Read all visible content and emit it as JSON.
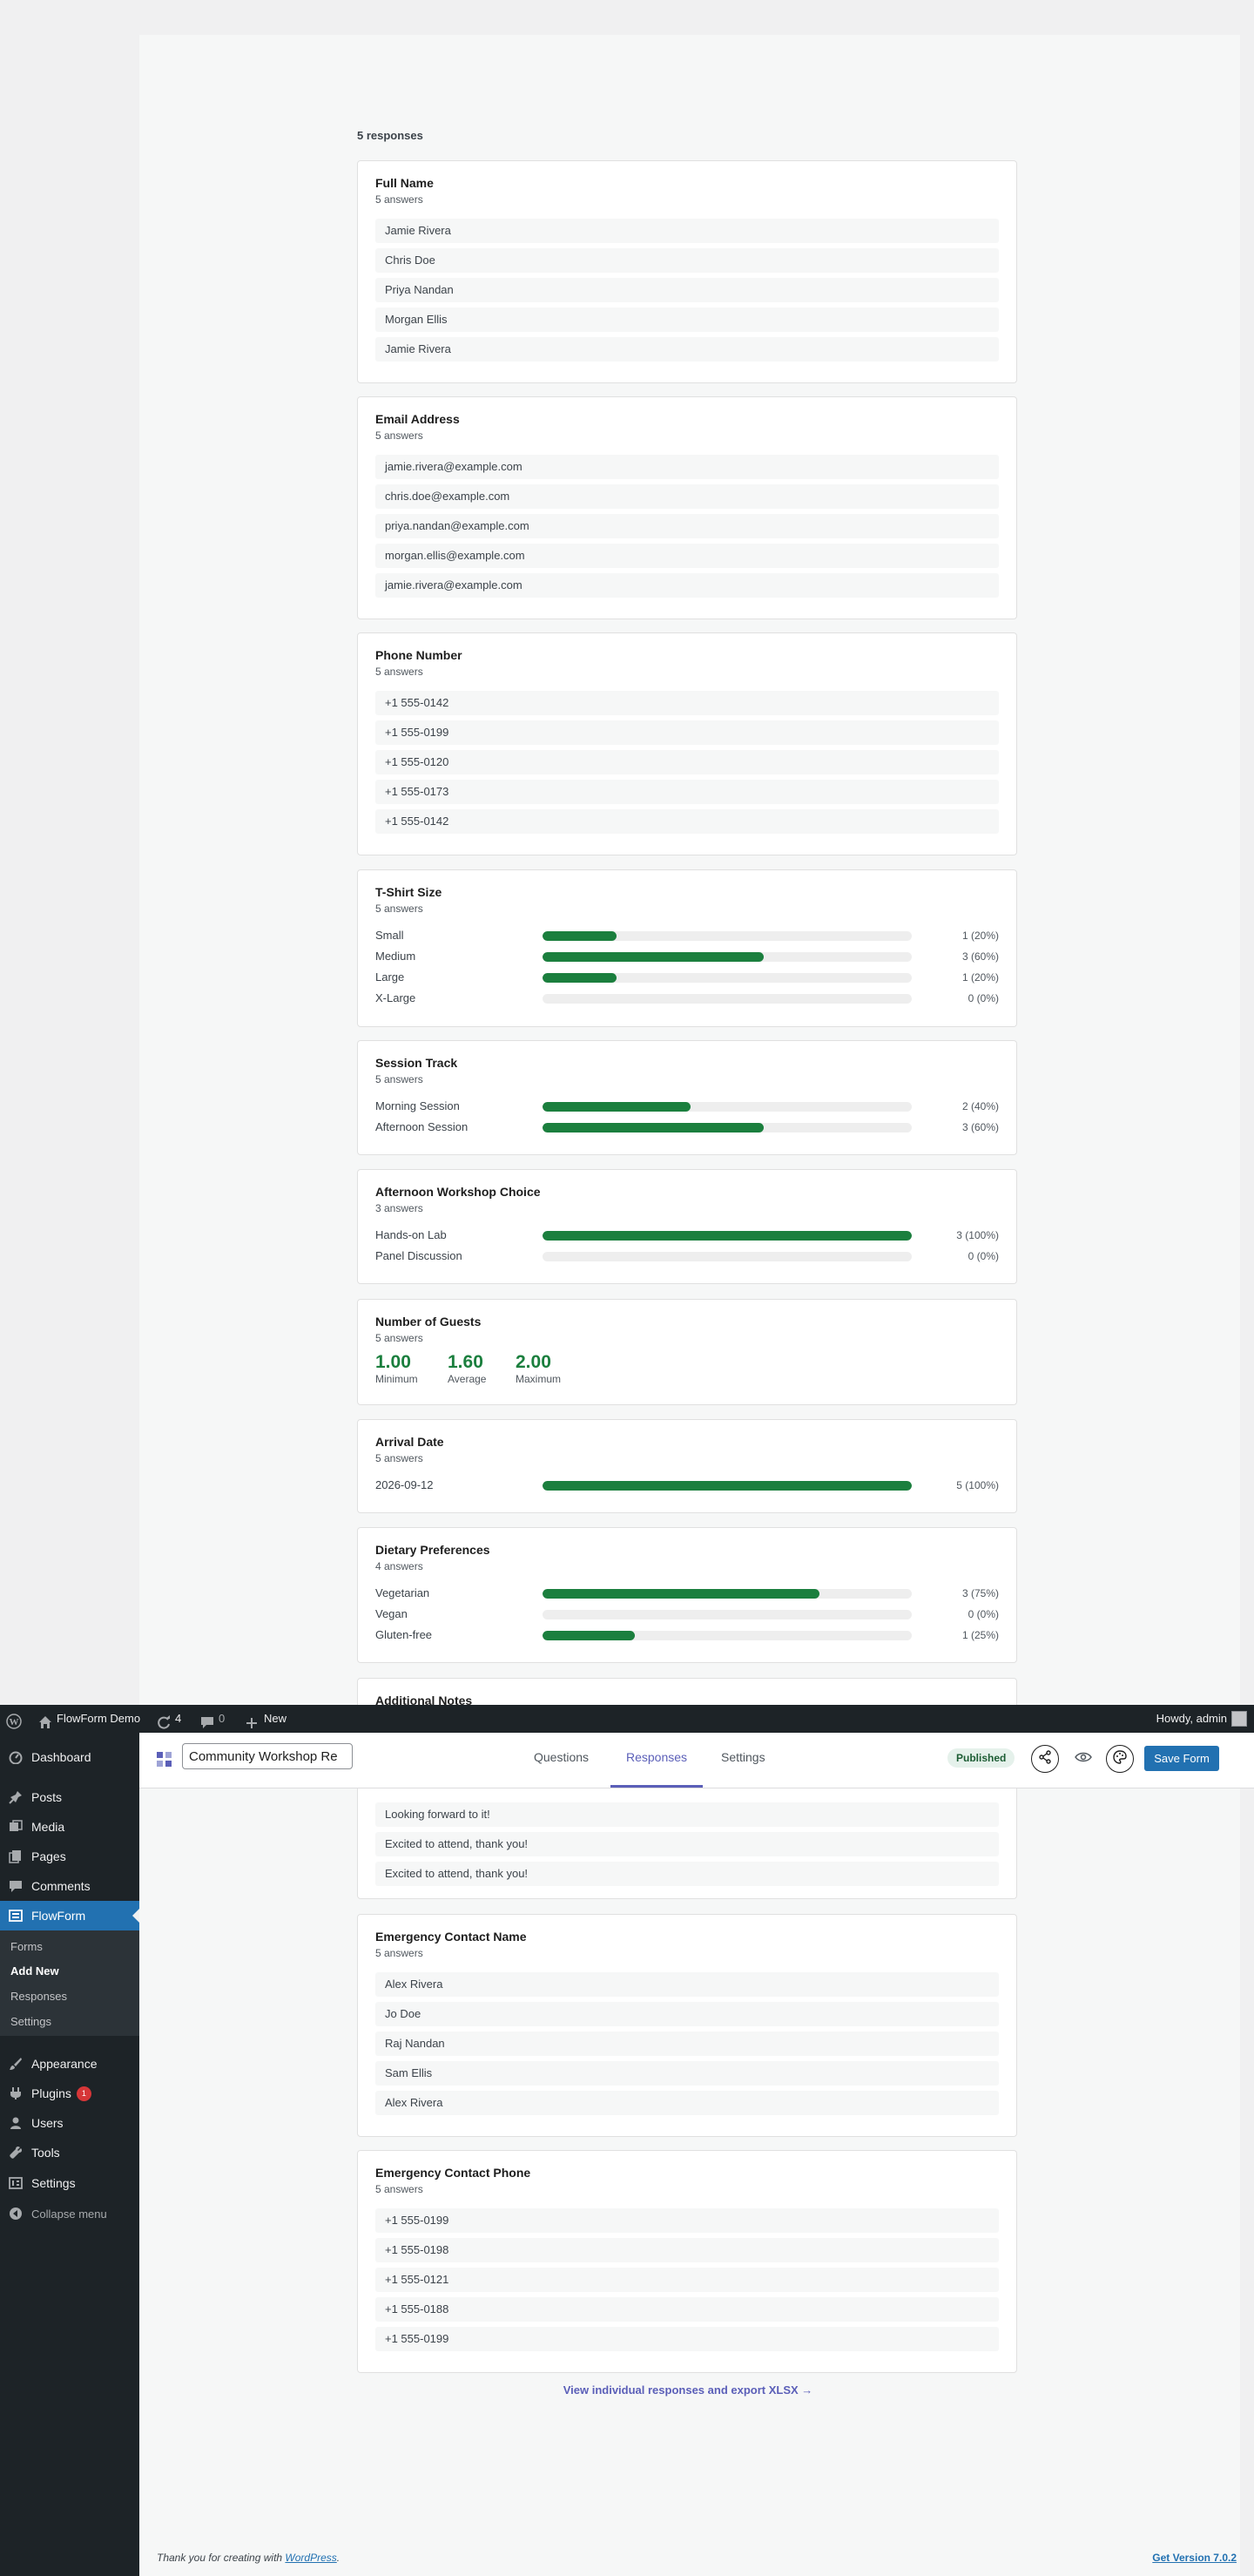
{
  "admin_bar": {
    "site_name": "FlowForm Demo",
    "updates_count": "4",
    "comments_count": "0",
    "new_label": "New",
    "howdy": "Howdy, admin"
  },
  "sidebar": {
    "items": [
      {
        "label": "Dashboard",
        "icon": "dashboard-icon"
      },
      {
        "label": "Posts",
        "icon": "pin-icon"
      },
      {
        "label": "Media",
        "icon": "media-icon"
      },
      {
        "label": "Pages",
        "icon": "pages-icon"
      },
      {
        "label": "Comments",
        "icon": "comments-icon"
      },
      {
        "label": "FlowForm",
        "icon": "form-icon"
      },
      {
        "label": "Appearance",
        "icon": "brush-icon"
      },
      {
        "label": "Plugins",
        "icon": "plug-icon",
        "badge": "1"
      },
      {
        "label": "Users",
        "icon": "user-icon"
      },
      {
        "label": "Tools",
        "icon": "wrench-icon"
      },
      {
        "label": "Settings",
        "icon": "settings-icon"
      },
      {
        "label": "Collapse menu",
        "icon": "collapse-icon"
      }
    ],
    "submenu": [
      "Forms",
      "Add New",
      "Responses",
      "Settings"
    ]
  },
  "editor": {
    "form_title": "Community Workshop Re",
    "tabs": [
      "Questions",
      "Responses",
      "Settings"
    ],
    "active_tab": "Responses",
    "status": "Published",
    "save_label": "Save Form"
  },
  "responses_count": "5 responses",
  "questions": {
    "full_name": {
      "title": "Full Name",
      "sub": "5 answers",
      "answers": [
        "Jamie Rivera",
        "Chris Doe",
        "Priya Nandan",
        "Morgan Ellis",
        "Jamie Rivera"
      ]
    },
    "email": {
      "title": "Email Address",
      "sub": "5 answers",
      "answers": [
        "jamie.rivera@example.com",
        "chris.doe@example.com",
        "priya.nandan@example.com",
        "morgan.ellis@example.com",
        "jamie.rivera@example.com"
      ]
    },
    "phone": {
      "title": "Phone Number",
      "sub": "5 answers",
      "answers": [
        "+1 555-0142",
        "+1 555-0199",
        "+1 555-0120",
        "+1 555-0173",
        "+1 555-0142"
      ]
    },
    "tshirt": {
      "title": "T-Shirt Size",
      "sub": "5 answers",
      "options": [
        {
          "label": "Small",
          "value": "1 (20%)",
          "pct": 0.2
        },
        {
          "label": "Medium",
          "value": "3 (60%)",
          "pct": 0.6
        },
        {
          "label": "Large",
          "value": "1 (20%)",
          "pct": 0.2
        },
        {
          "label": "X-Large",
          "value": "0 (0%)",
          "pct": 0
        }
      ]
    },
    "session": {
      "title": "Session Track",
      "sub": "5 answers",
      "options": [
        {
          "label": "Morning Session",
          "value": "2 (40%)",
          "pct": 0.4
        },
        {
          "label": "Afternoon Session",
          "value": "3 (60%)",
          "pct": 0.6
        }
      ]
    },
    "workshop": {
      "title": "Afternoon Workshop Choice",
      "sub": "3 answers",
      "options": [
        {
          "label": "Hands-on Lab",
          "value": "3 (100%)",
          "pct": 1.0
        },
        {
          "label": "Panel Discussion",
          "value": "0 (0%)",
          "pct": 0
        }
      ]
    },
    "guests": {
      "title": "Number of Guests",
      "sub": "5 answers",
      "stats": [
        {
          "value": "1.00",
          "label": "Minimum"
        },
        {
          "value": "1.60",
          "label": "Average"
        },
        {
          "value": "2.00",
          "label": "Maximum"
        }
      ]
    },
    "arrival": {
      "title": "Arrival Date",
      "sub": "5 answers",
      "options": [
        {
          "label": "2026-09-12",
          "value": "5 (100%)",
          "pct": 1.0
        }
      ]
    },
    "dietary": {
      "title": "Dietary Preferences",
      "sub": "4 answers",
      "options": [
        {
          "label": "Vegetarian",
          "value": "3 (75%)",
          "pct": 0.75
        },
        {
          "label": "Vegan",
          "value": "0 (0%)",
          "pct": 0
        },
        {
          "label": "Gluten-free",
          "value": "1 (25%)",
          "pct": 0.25
        }
      ]
    },
    "notes": {
      "title": "Additional Notes",
      "answers": [
        "Looking forward to it!",
        "Excited to attend, thank you!",
        "Excited to attend, thank you!"
      ]
    },
    "ec_name": {
      "title": "Emergency Contact Name",
      "sub": "5 answers",
      "answers": [
        "Alex Rivera",
        "Jo Doe",
        "Raj Nandan",
        "Sam Ellis",
        "Alex Rivera"
      ]
    },
    "ec_phone": {
      "title": "Emergency Contact Phone",
      "sub": "5 answers",
      "answers": [
        "+1 555-0199",
        "+1 555-0198",
        "+1 555-0121",
        "+1 555-0188",
        "+1 555-0199"
      ]
    }
  },
  "view_link": "View individual responses and export XLSX →",
  "footer": {
    "thanks_prefix": "Thank you for creating with",
    "wordpress_link": "WordPress",
    "thanks_suffix": ".",
    "version": "Get Version 7.0.2"
  },
  "colors": {
    "accent": "#1b7f3e",
    "brand": "#2271b1",
    "tab_active": "#5b5fb8"
  }
}
